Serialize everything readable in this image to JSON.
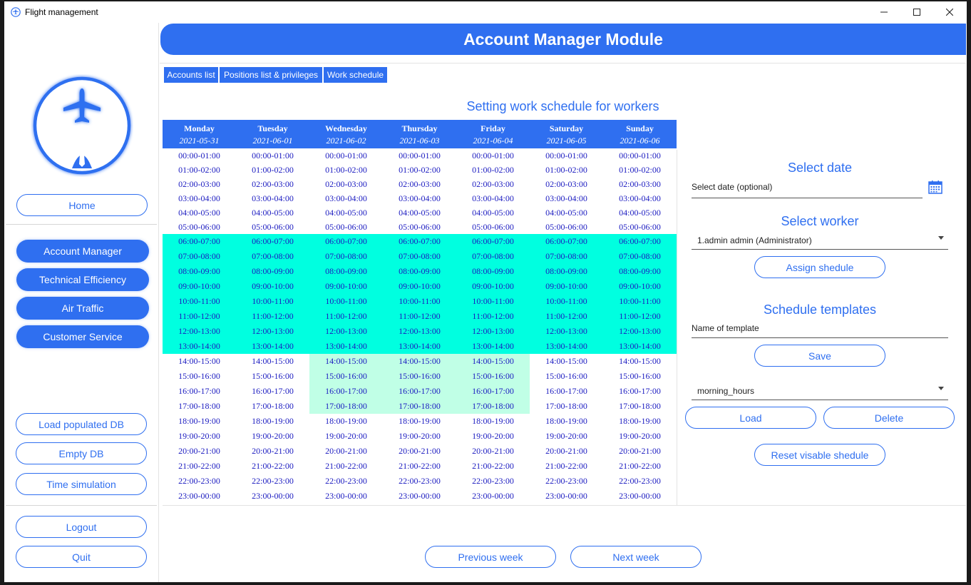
{
  "window": {
    "title": "Flight management",
    "icons": {
      "app": "airplane-icon",
      "minimize": "minimize-icon",
      "maximize": "maximize-icon",
      "close": "close-icon"
    }
  },
  "header": {
    "title": "Account Manager Module"
  },
  "sidebar": {
    "home": "Home",
    "modules": [
      "Account Manager",
      "Technical Efficiency",
      "Air Traffic",
      "Customer Service"
    ],
    "db_tools": [
      "Load populated DB",
      "Empty DB",
      "Time simulation"
    ],
    "session": {
      "logout": "Logout",
      "quit": "Quit"
    }
  },
  "tabs": [
    {
      "label": "Accounts list"
    },
    {
      "label": "Positions list & privileges"
    },
    {
      "label": "Work schedule"
    }
  ],
  "schedule": {
    "title": "Setting work schedule for workers",
    "days": [
      {
        "name": "Monday",
        "date": "2021-05-31",
        "mint": false
      },
      {
        "name": "Tuesday",
        "date": "2021-06-01",
        "mint": false
      },
      {
        "name": "Wednesday",
        "date": "2021-06-02",
        "mint": true
      },
      {
        "name": "Thursday",
        "date": "2021-06-03",
        "mint": true
      },
      {
        "name": "Friday",
        "date": "2021-06-04",
        "mint": true
      },
      {
        "name": "Saturday",
        "date": "2021-06-05",
        "mint": false
      },
      {
        "name": "Sunday",
        "date": "2021-06-06",
        "mint": false
      }
    ],
    "slots": [
      "00:00-01:00",
      "01:00-02:00",
      "02:00-03:00",
      "03:00-04:00",
      "04:00-05:00",
      "05:00-06:00",
      "06:00-07:00",
      "07:00-08:00",
      "08:00-09:00",
      "09:00-10:00",
      "10:00-11:00",
      "11:00-12:00",
      "12:00-13:00",
      "13:00-14:00",
      "14:00-15:00",
      "15:00-16:00",
      "16:00-17:00",
      "17:00-18:00",
      "18:00-19:00",
      "19:00-20:00",
      "20:00-21:00",
      "21:00-22:00",
      "22:00-23:00",
      "23:00-00:00"
    ],
    "colors": {
      "selected_all": "#00ffe0",
      "selected_partial": "#c0ffe6",
      "slot_text": "#1a1ac0",
      "accent": "#2f6ff0"
    }
  },
  "select_date": {
    "title": "Select date",
    "placeholder": "Select date (optional)",
    "icon": "calendar-icon"
  },
  "select_worker": {
    "title": "Select worker",
    "value": "1.admin admin (Administrator)",
    "assign": "Assign shedule"
  },
  "templates": {
    "title": "Schedule templates",
    "placeholder": "Name of template",
    "save": "Save",
    "selected": "morning_hours",
    "load": "Load",
    "delete": "Delete",
    "reset": "Reset visable shedule"
  },
  "nav": {
    "prev": "Previous week",
    "next": "Next week"
  }
}
